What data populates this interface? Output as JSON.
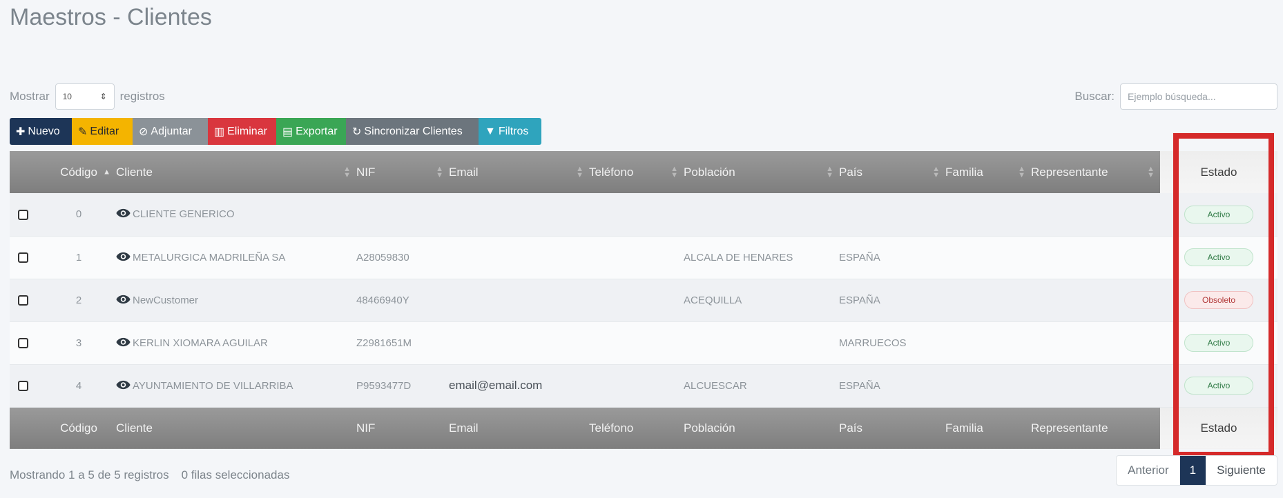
{
  "page": {
    "title": "Maestros - Clientes"
  },
  "length": {
    "label_before": "Mostrar",
    "value": "10",
    "label_after": "registros"
  },
  "search": {
    "label": "Buscar:",
    "placeholder": "Ejemplo búsqueda..."
  },
  "toolbar": {
    "nuevo": "Nuevo",
    "editar": "Editar",
    "adjuntar": "Adjuntar",
    "eliminar": "Eliminar",
    "exportar": "Exportar",
    "sincronizar": "Sincronizar Clientes",
    "filtros": "Filtros"
  },
  "table": {
    "columns": [
      "Código",
      "Cliente",
      "NIF",
      "Email",
      "Teléfono",
      "Población",
      "País",
      "Familia",
      "Representante",
      "Estado"
    ],
    "rows": [
      {
        "codigo": "0",
        "cliente": "CLIENTE GENERICO",
        "nif": "",
        "email": "",
        "telefono": "",
        "poblacion": "",
        "pais": "",
        "familia": "",
        "representante": "",
        "estado": "Activo",
        "estado_kind": "activo"
      },
      {
        "codigo": "1",
        "cliente": "METALURGICA MADRILEÑA SA",
        "nif": "A28059830",
        "email": "",
        "telefono": "",
        "poblacion": "ALCALA DE HENARES",
        "pais": "ESPAÑA",
        "familia": "",
        "representante": "",
        "estado": "Activo",
        "estado_kind": "activo"
      },
      {
        "codigo": "2",
        "cliente": "NewCustomer",
        "nif": "48466940Y",
        "email": "",
        "telefono": "",
        "poblacion": "ACEQUILLA",
        "pais": "ESPAÑA",
        "familia": "",
        "representante": "",
        "estado": "Obsoleto",
        "estado_kind": "obsoleto"
      },
      {
        "codigo": "3",
        "cliente": "KERLIN XIOMARA AGUILAR",
        "nif": "Z2981651M",
        "email": "",
        "telefono": "",
        "poblacion": "",
        "pais": "MARRUECOS",
        "familia": "",
        "representante": "",
        "estado": "Activo",
        "estado_kind": "activo"
      },
      {
        "codigo": "4",
        "cliente": "AYUNTAMIENTO DE VILLARRIBA",
        "nif": "P9593477D",
        "email": "email@email.com",
        "telefono": "",
        "poblacion": "ALCUESCAR",
        "pais": "ESPAÑA",
        "familia": "",
        "representante": "",
        "estado": "Activo",
        "estado_kind": "activo"
      }
    ]
  },
  "info": {
    "summary": "Mostrando 1 a 5 de 5 registros",
    "selected": "0 filas seleccionadas"
  },
  "pagination": {
    "prev": "Anterior",
    "current": "1",
    "next": "Siguiente"
  },
  "colors": {
    "primary": "#1d3557",
    "highlight": "#d52a2a"
  }
}
